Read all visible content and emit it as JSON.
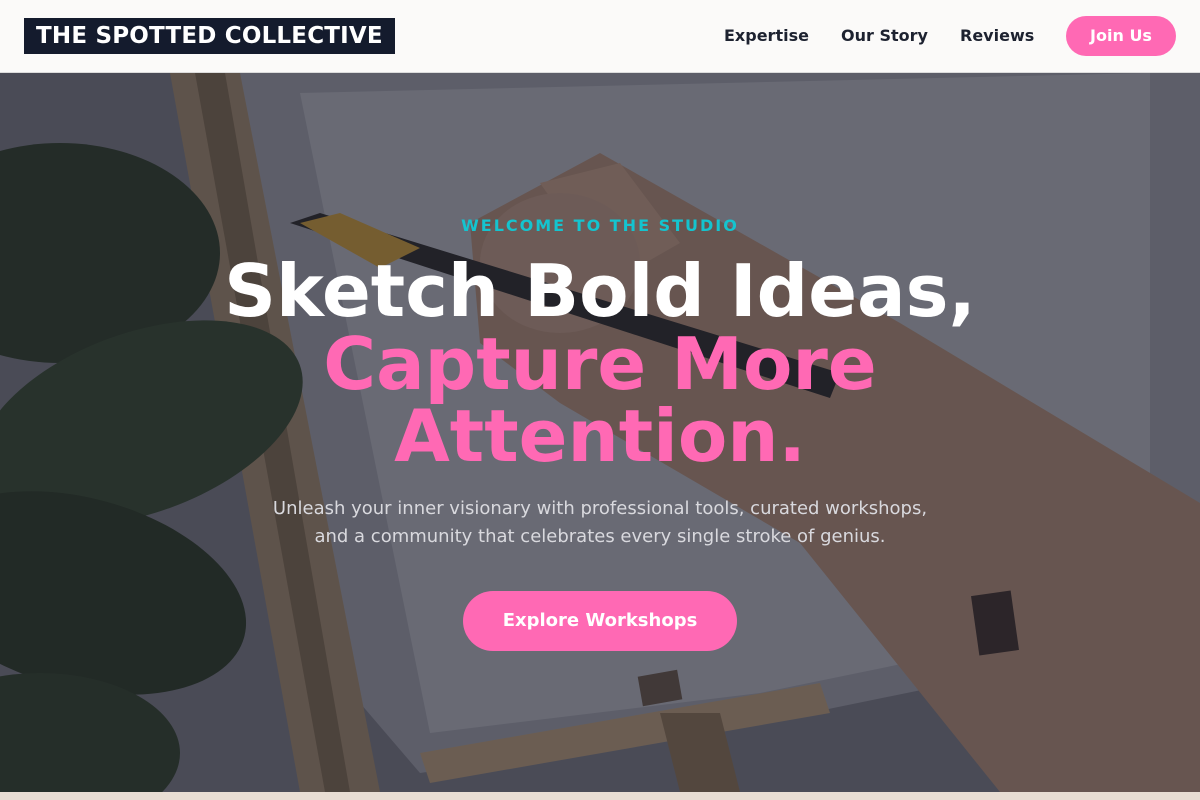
{
  "header": {
    "logo_text": "THE SPOTTED COLLECTIVE",
    "nav": {
      "expertise": "Expertise",
      "our_story": "Our Story",
      "reviews": "Reviews"
    },
    "join_label": "Join Us"
  },
  "hero": {
    "eyebrow": "WELCOME TO THE STUDIO",
    "headline_line1": "Sketch Bold Ideas,",
    "headline_line2": "Capture More",
    "headline_line3": "Attention.",
    "subtext_line1": "Unleash your inner visionary with professional tools, curated workshops,",
    "subtext_line2": "and a community that celebrates every single stroke of genius.",
    "cta_label": "Explore Workshops",
    "background_image": "hand-painting-on-easel-canvas-photo"
  },
  "colors": {
    "accent_pink": "#ff69b4",
    "accent_teal": "#14c4cf",
    "logo_bg": "#141b2d",
    "header_bg": "#fbfaf9"
  }
}
